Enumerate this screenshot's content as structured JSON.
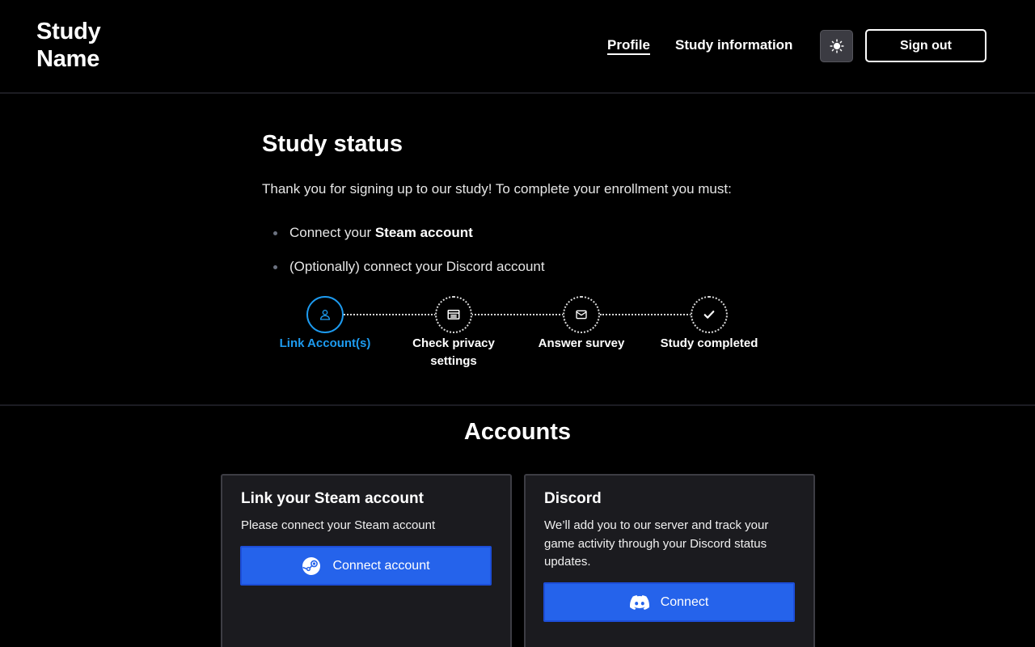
{
  "header": {
    "brand_line1": "Study",
    "brand_line2": "Name",
    "nav": {
      "profile": "Profile",
      "study_information": "Study information"
    },
    "theme_toggle_icon": "sun-icon",
    "sign_out_label": "Sign out"
  },
  "status": {
    "title": "Study status",
    "intro": "Thank you for signing up to our study! To complete your enrollment you must:",
    "requirements": [
      {
        "prefix": "Connect your ",
        "bold": "Steam account"
      },
      {
        "prefix": "(Optionally) connect your Discord account",
        "bold": ""
      }
    ],
    "steps": [
      {
        "label": "Link Account(s)",
        "icon": "user-icon",
        "state": "active"
      },
      {
        "label": "Check privacy settings",
        "icon": "list-icon",
        "state": "pending"
      },
      {
        "label": "Answer survey",
        "icon": "mail-icon",
        "state": "pending"
      },
      {
        "label": "Study completed",
        "icon": "check-icon",
        "state": "pending"
      }
    ]
  },
  "accounts": {
    "title": "Accounts",
    "steam": {
      "title": "Link your Steam account",
      "description": "Please connect your Steam account",
      "button_label": "Connect account",
      "button_icon": "steam-icon"
    },
    "discord": {
      "title": "Discord",
      "description": "We’ll add you to our server and track your game activity through your Discord status updates.",
      "button_label": "Connect",
      "button_icon": "discord-icon"
    }
  },
  "colors": {
    "background": "#000000",
    "accent_blue": "#1d9bf0",
    "button_blue": "#2563eb",
    "card_bg": "#1b1b1f"
  }
}
